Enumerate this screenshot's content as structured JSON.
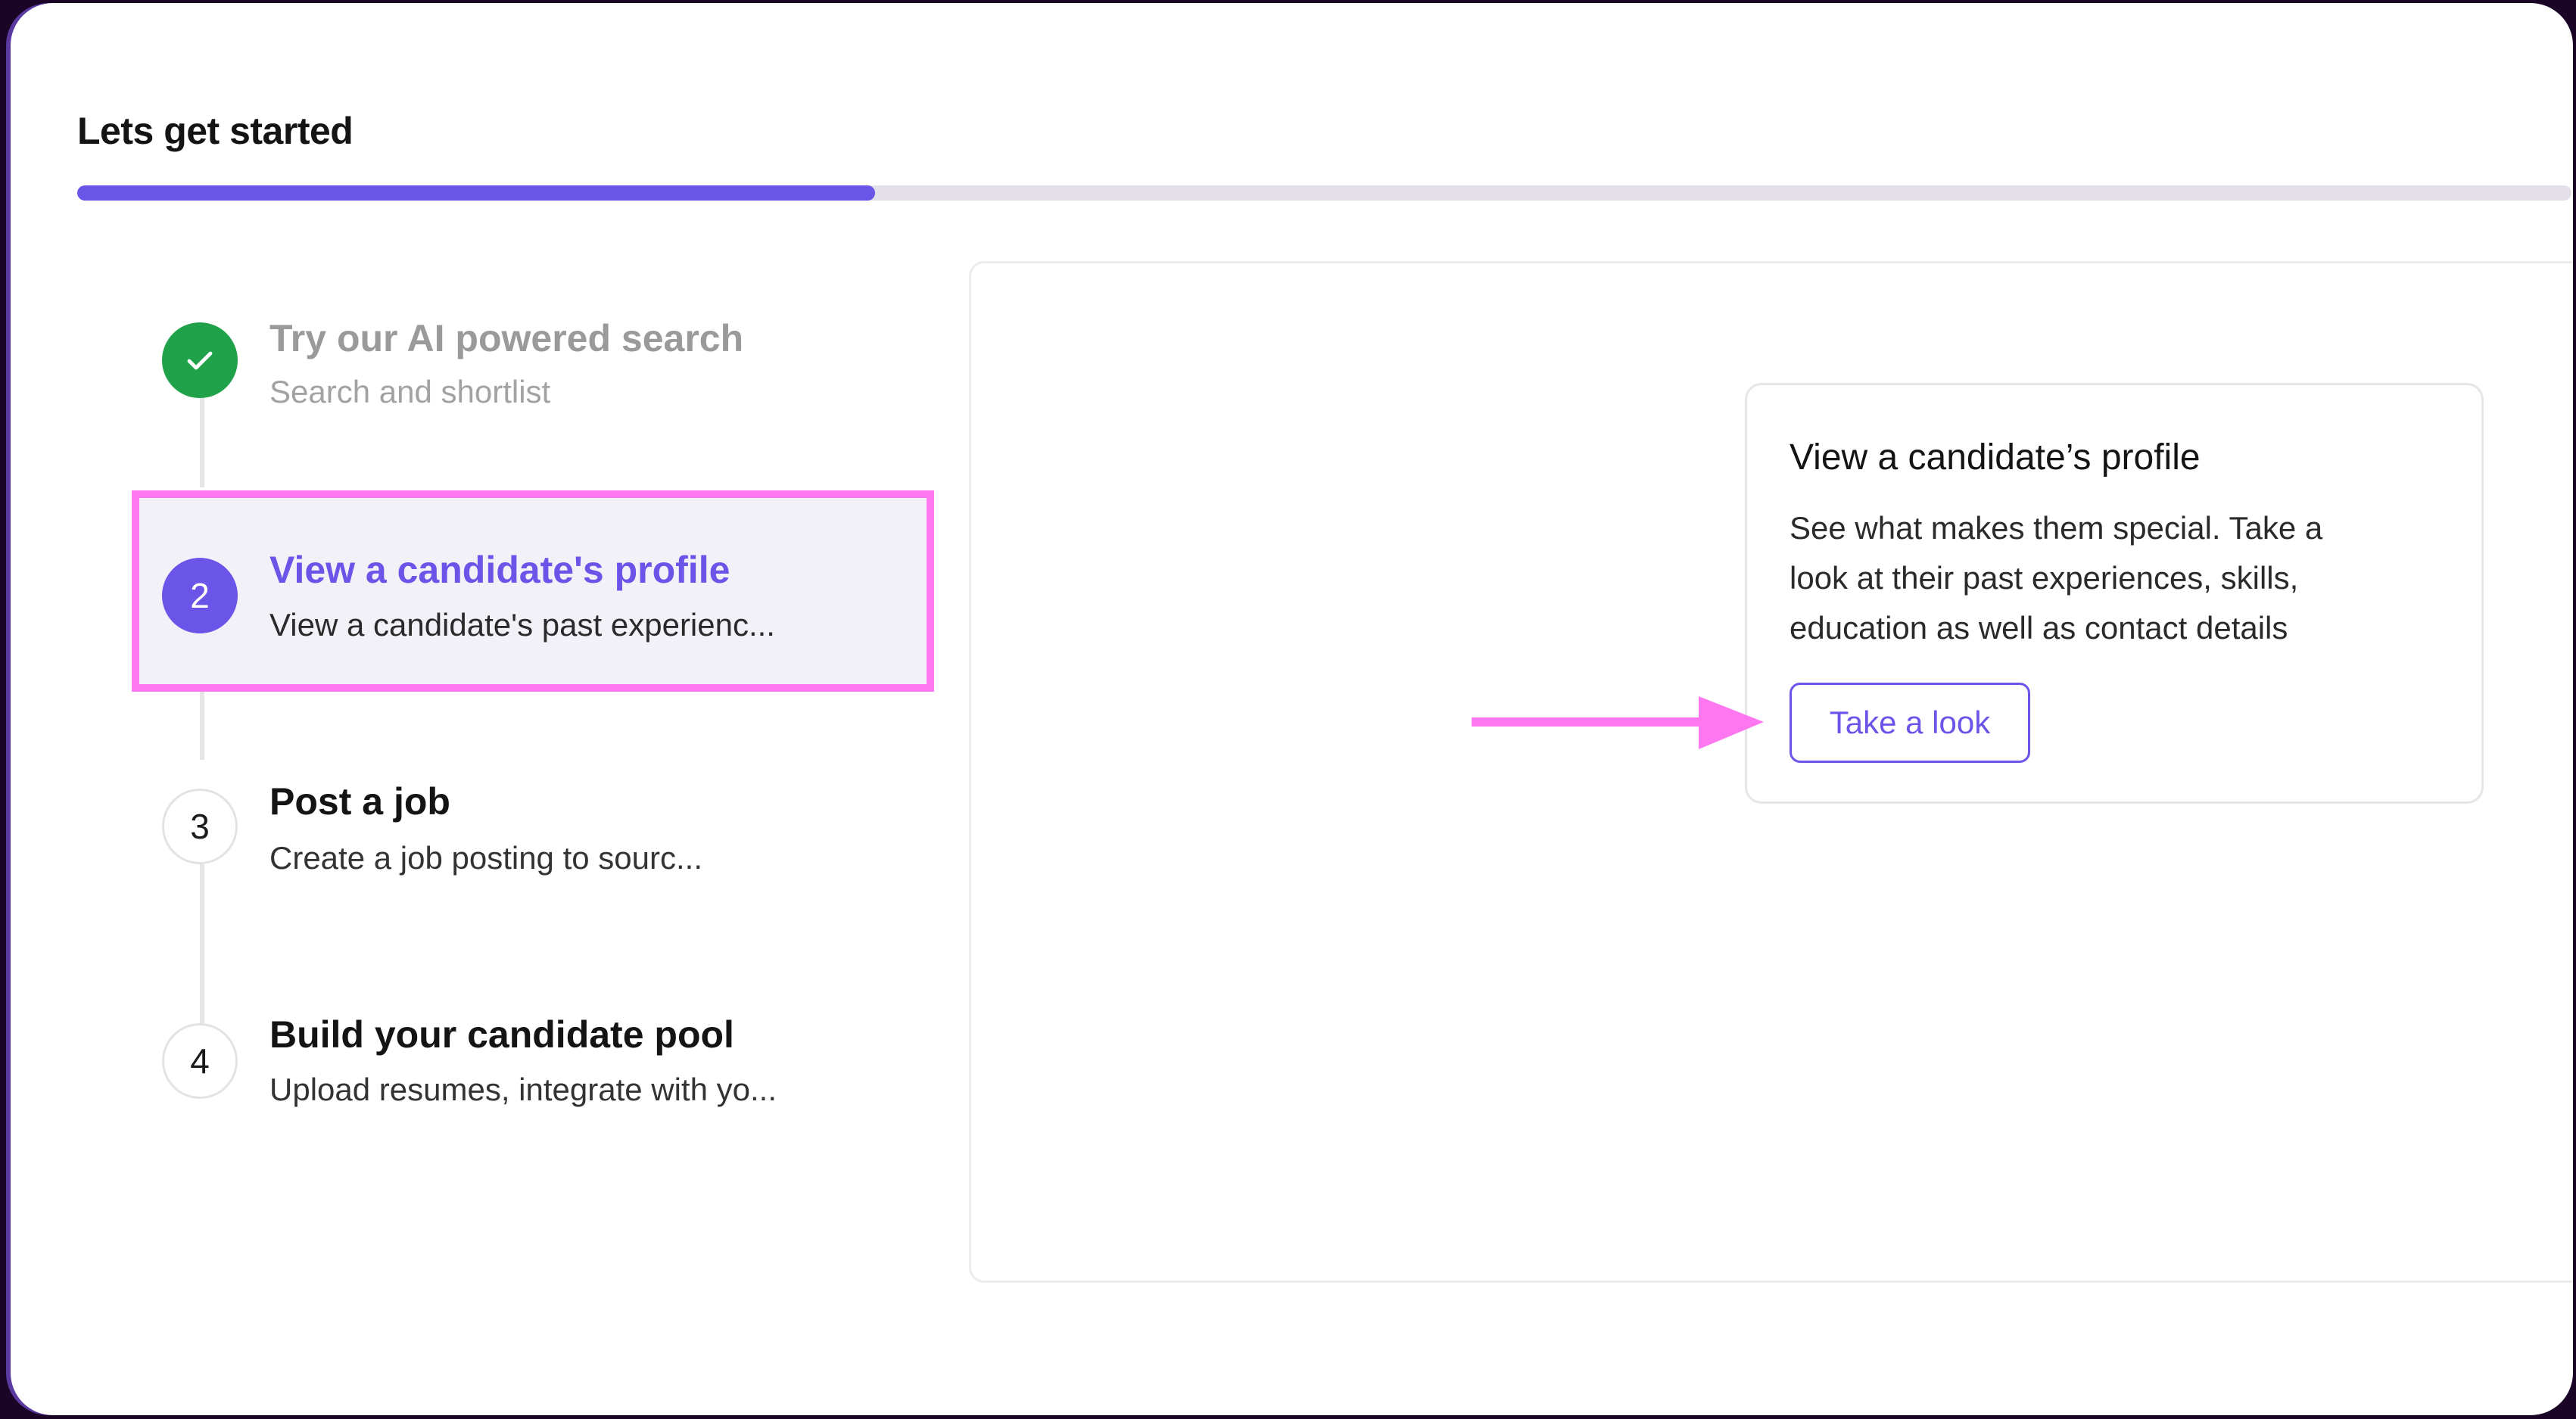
{
  "page": {
    "title": "Lets get started",
    "progress_percent": 32,
    "colors": {
      "accent": "#6a55e8",
      "done": "#20a24a",
      "highlight": "#ff77f0"
    }
  },
  "steps": [
    {
      "status": "done",
      "marker": "",
      "icon": "checkmark-icon",
      "title": "Try our AI powered search",
      "subtitle": "Search and shortlist"
    },
    {
      "status": "active",
      "marker": "2",
      "title": "View a candidate's profile",
      "subtitle": "View a candidate's past experienc..."
    },
    {
      "status": "pending",
      "marker": "3",
      "title": "Post a job",
      "subtitle": "Create a job posting to sourc..."
    },
    {
      "status": "pending",
      "marker": "4",
      "title": "Build your candidate pool",
      "subtitle": "Upload resumes, integrate with yo..."
    }
  ],
  "card": {
    "title": "View a candidate’s profile",
    "description_lines": [
      "See what makes them special. Take a",
      "look at their past experiences, skills,",
      "education as well as contact details"
    ],
    "button_label": "Take a look"
  },
  "annotations": {
    "arrow_icon": "right-arrow-icon"
  }
}
